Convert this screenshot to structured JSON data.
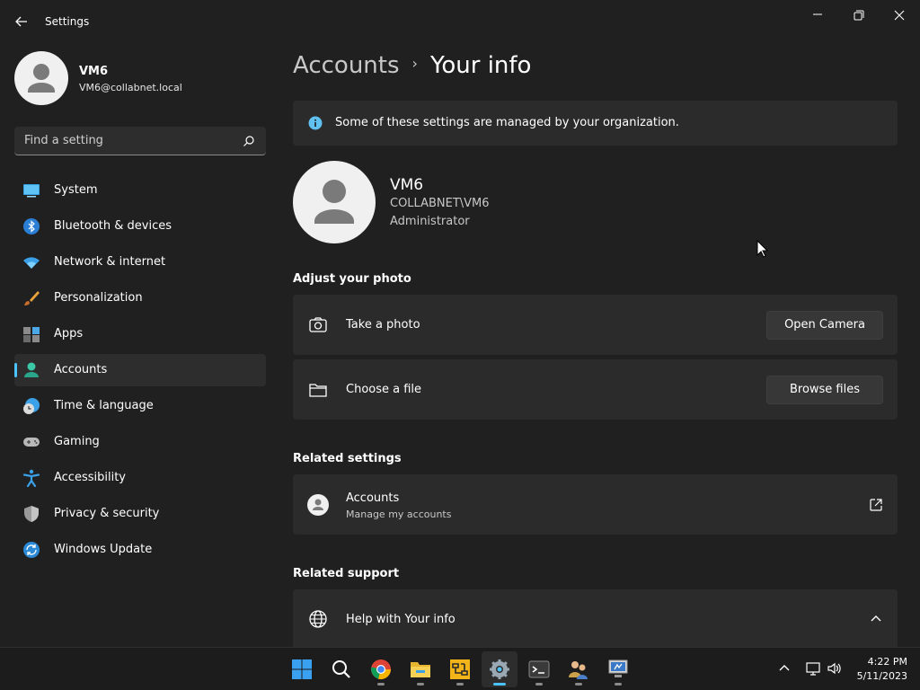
{
  "window": {
    "title": "Settings"
  },
  "profile": {
    "name": "VM6",
    "email": "VM6@collabnet.local"
  },
  "search": {
    "placeholder": "Find a setting"
  },
  "nav": {
    "items": [
      {
        "label": "System",
        "icon": "system-icon"
      },
      {
        "label": "Bluetooth & devices",
        "icon": "bluetooth-icon"
      },
      {
        "label": "Network & internet",
        "icon": "wifi-icon"
      },
      {
        "label": "Personalization",
        "icon": "brush-icon"
      },
      {
        "label": "Apps",
        "icon": "apps-icon"
      },
      {
        "label": "Accounts",
        "icon": "accounts-icon",
        "active": true
      },
      {
        "label": "Time & language",
        "icon": "clock-globe-icon"
      },
      {
        "label": "Gaming",
        "icon": "gamepad-icon"
      },
      {
        "label": "Accessibility",
        "icon": "accessibility-icon"
      },
      {
        "label": "Privacy & security",
        "icon": "shield-icon"
      },
      {
        "label": "Windows Update",
        "icon": "update-icon"
      }
    ]
  },
  "breadcrumb": {
    "parent": "Accounts",
    "separator": "›",
    "current": "Your info"
  },
  "info_bar": {
    "text": "Some of these settings are managed by your organization."
  },
  "user": {
    "name": "VM6",
    "domain": "COLLABNET\\VM6",
    "role": "Administrator"
  },
  "adjust_photo": {
    "title": "Adjust your photo",
    "take_photo_label": "Take a photo",
    "open_camera_button": "Open Camera",
    "choose_file_label": "Choose a file",
    "browse_files_button": "Browse files"
  },
  "related_settings": {
    "title": "Related settings",
    "accounts_label": "Accounts",
    "accounts_sub": "Manage my accounts"
  },
  "related_support": {
    "title": "Related support",
    "help_label": "Help with Your info"
  },
  "taskbar": {
    "apps": [
      "start",
      "search",
      "chrome",
      "file-explorer",
      "network-tool",
      "settings",
      "terminal",
      "user-manager",
      "remote-desktop"
    ],
    "active_app": "settings"
  },
  "clock": {
    "time": "4:22 PM",
    "date": "5/11/2023"
  },
  "colors": {
    "background": "#202020",
    "card": "#2b2b2b",
    "accent": "#4cc2ff",
    "taskbar": "#1c1c1c"
  }
}
